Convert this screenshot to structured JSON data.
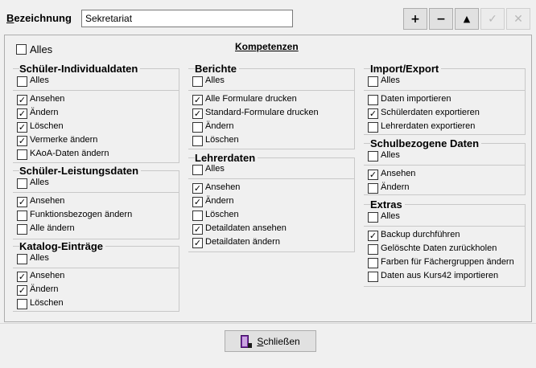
{
  "header": {
    "label_first": "B",
    "label_rest": "ezeichnung",
    "name_value": "Sekretariat"
  },
  "toolbar": {
    "add": "+",
    "remove": "−",
    "up": "▲",
    "apply": "✓",
    "cancel": "✕"
  },
  "main": {
    "alles_label": "Alles",
    "title": "Kompetenzen",
    "groups": {
      "schueler_individual": {
        "title": "Schüler-Individualdaten",
        "alles": "Alles",
        "items": [
          "Ansehen",
          "Ändern",
          "Löschen",
          "Vermerke ändern",
          "KAoA-Daten ändern"
        ]
      },
      "schueler_leistung": {
        "title": "Schüler-Leistungsdaten",
        "alles": "Alles",
        "items": [
          "Ansehen",
          "Funktionsbezogen ändern",
          "Alle ändern"
        ]
      },
      "katalog": {
        "title": "Katalog-Einträge",
        "alles": "Alles",
        "items": [
          "Ansehen",
          "Ändern",
          "Löschen"
        ]
      },
      "berichte": {
        "title": "Berichte",
        "alles": "Alles",
        "items": [
          "Alle Formulare drucken",
          "Standard-Formulare drucken",
          "Ändern",
          "Löschen"
        ]
      },
      "lehrerdaten": {
        "title": "Lehrerdaten",
        "alles": "Alles",
        "items": [
          "Ansehen",
          "Ändern",
          "Löschen",
          "Detaildaten ansehen",
          "Detaildaten ändern"
        ]
      },
      "import_export": {
        "title": "Import/Export",
        "alles": "Alles",
        "items": [
          "Daten importieren",
          "Schülerdaten exportieren",
          "Lehrerdaten exportieren"
        ]
      },
      "schulbezogene": {
        "title": "Schulbezogene Daten",
        "alles": "Alles",
        "items": [
          "Ansehen",
          "Ändern"
        ]
      },
      "extras": {
        "title": "Extras",
        "alles": "Alles",
        "items": [
          "Backup durchführen",
          "Gelöschte Daten zurückholen",
          "Farben für Fächergruppen ändern",
          "Daten aus Kurs42 importieren"
        ]
      }
    }
  },
  "footer": {
    "close_first": "S",
    "close_rest": "chließen"
  },
  "check_mark": "✓"
}
